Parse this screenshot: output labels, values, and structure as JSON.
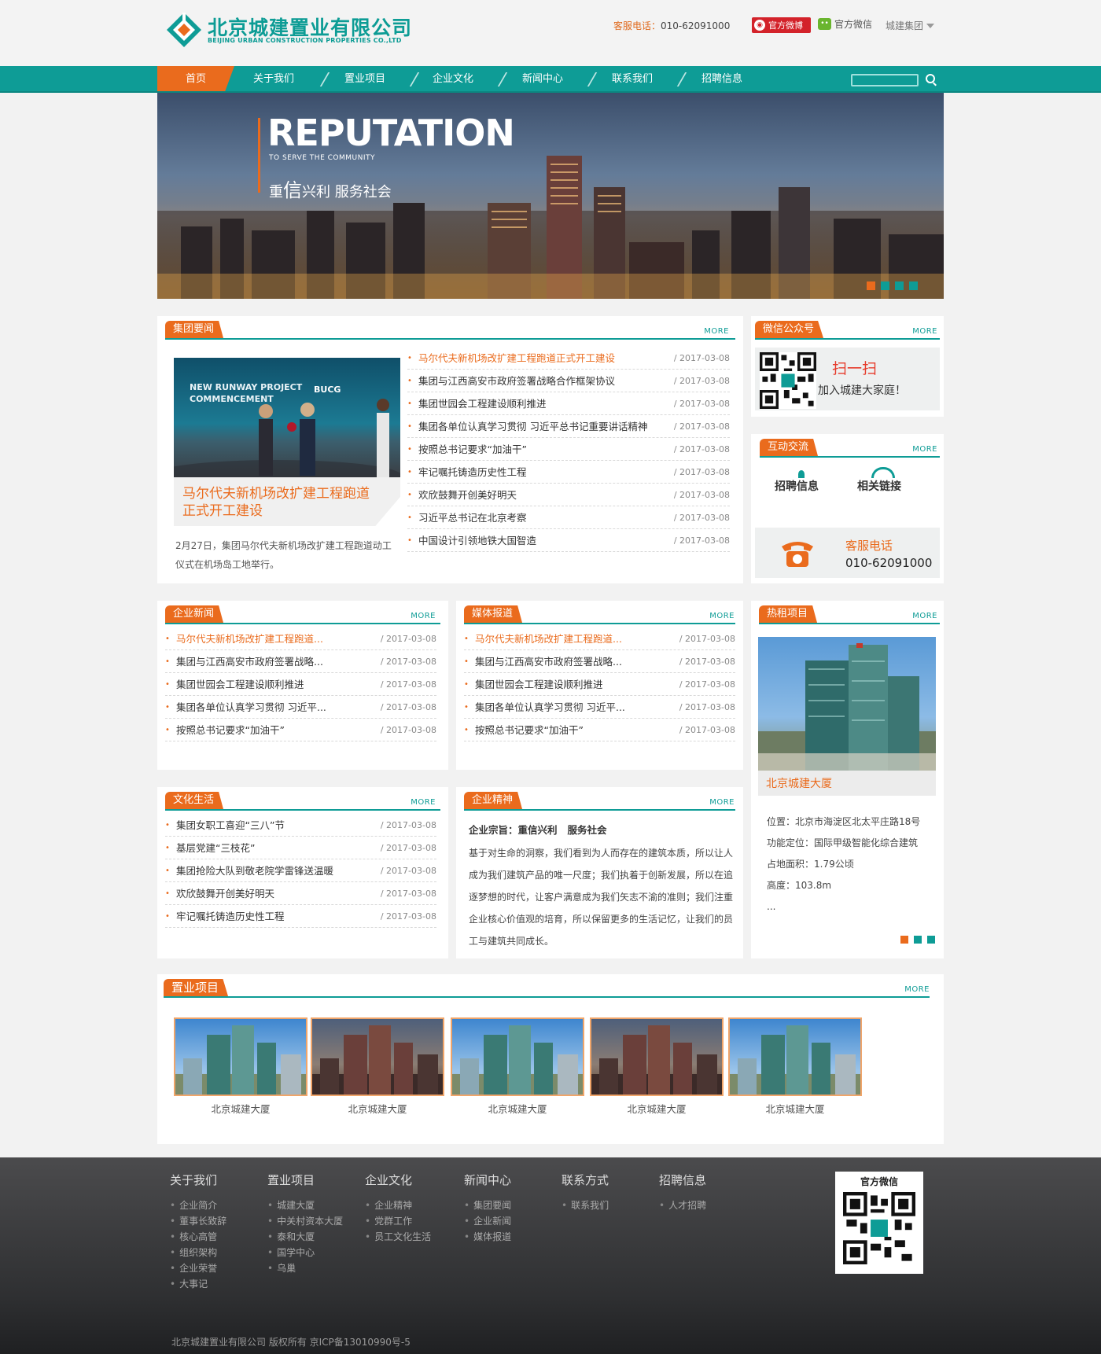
{
  "header": {
    "logo_cn": "北京城建置业有限公司",
    "logo_en": "BEIJING URBAN CONSTRUCTION PROPERTIES CO.,LTD",
    "hotline_label": "客服电话：",
    "hotline_number": "010-62091000",
    "weibo_label": "官方微博",
    "wechat_label": "官方微信",
    "group_label": "城建集团"
  },
  "nav": {
    "items": [
      "首页",
      "关于我们",
      "置业项目",
      "企业文化",
      "新闻中心",
      "联系我们",
      "招聘信息"
    ],
    "active_index": 0
  },
  "banner": {
    "title": "REPUTATION",
    "subtitle": "TO SERVE THE COMMUNITY",
    "slogan_prefix": "重",
    "slogan_big": "信",
    "slogan_rest": "兴利    服务社会"
  },
  "group_news": {
    "title": "集团要闻",
    "more": "MORE",
    "feature_photo_caption_lines": [
      "NEW RUNWAY PROJECT",
      "COMMENCEMENT",
      "BUCG"
    ],
    "feature_headline": "马尔代夫新机场改扩建工程跑道正式开工建设",
    "feature_summary": "2月27日，集团马尔代夫新机场改扩建工程跑道动工仪式在机场岛工地举行。",
    "items": [
      {
        "title": "马尔代夫新机场改扩建工程跑道正式开工建设",
        "date": "/ 2017-03-08"
      },
      {
        "title": "集团与江西高安市政府签署战略合作框架协议",
        "date": "/ 2017-03-08"
      },
      {
        "title": "集团世园会工程建设顺利推进",
        "date": "/ 2017-03-08"
      },
      {
        "title": "集团各单位认真学习贯彻 习近平总书记重要讲话精神",
        "date": "/ 2017-03-08"
      },
      {
        "title": "按照总书记要求“加油干”",
        "date": "/ 2017-03-08"
      },
      {
        "title": "牢记嘱托铸造历史性工程",
        "date": "/ 2017-03-08"
      },
      {
        "title": "欢欣鼓舞开创美好明天",
        "date": "/ 2017-03-08"
      },
      {
        "title": "习近平总书记在北京考察",
        "date": "/ 2017-03-08"
      },
      {
        "title": "中国设计引领地铁大国智造",
        "date": "/ 2017-03-08"
      }
    ]
  },
  "wechat_panel": {
    "title": "微信公众号",
    "more": "MORE",
    "scan": "扫一扫",
    "join": "加入城建大家庭！"
  },
  "interact": {
    "title": "互动交流",
    "more": "MORE",
    "recruit": "招聘信息",
    "links": "相关链接",
    "phone_label": "客服电话",
    "phone_number": "010-62091000"
  },
  "company_news": {
    "title": "企业新闻",
    "more": "MORE",
    "items": [
      {
        "title": "马尔代夫新机场改扩建工程跑道...",
        "date": "/ 2017-03-08"
      },
      {
        "title": "集团与江西高安市政府签署战略...",
        "date": "/ 2017-03-08"
      },
      {
        "title": "集团世园会工程建设顺利推进",
        "date": "/ 2017-03-08"
      },
      {
        "title": "集团各单位认真学习贯彻 习近平...",
        "date": "/ 2017-03-08"
      },
      {
        "title": "按照总书记要求“加油干”",
        "date": "/ 2017-03-08"
      }
    ]
  },
  "media_news": {
    "title": "媒体报道",
    "more": "MORE",
    "items": [
      {
        "title": "马尔代夫新机场改扩建工程跑道...",
        "date": "/ 2017-03-08"
      },
      {
        "title": "集团与江西高安市政府签署战略...",
        "date": "/ 2017-03-08"
      },
      {
        "title": "集团世园会工程建设顺利推进",
        "date": "/ 2017-03-08"
      },
      {
        "title": "集团各单位认真学习贯彻 习近平...",
        "date": "/ 2017-03-08"
      },
      {
        "title": "按照总书记要求“加油干”",
        "date": "/ 2017-03-08"
      }
    ]
  },
  "culture_life": {
    "title": "文化生活",
    "more": "MORE",
    "items": [
      {
        "title": "集团女职工喜迎“三八”节",
        "date": "/ 2017-03-08"
      },
      {
        "title": "基层党建“三枝花”",
        "date": "/ 2017-03-08"
      },
      {
        "title": "集团抢险大队到敬老院学雷锋送温暖",
        "date": "/ 2017-03-08"
      },
      {
        "title": "欢欣鼓舞开创美好明天",
        "date": "/ 2017-03-08"
      },
      {
        "title": "牢记嘱托铸造历史性工程",
        "date": "/ 2017-03-08"
      }
    ]
  },
  "spirit": {
    "title": "企业精神",
    "more": "MORE",
    "heading": "企业宗旨：重信兴利   服务社会",
    "lines": [
      "基于对生命的洞察，我们看到为人而存在的建筑本质，所以让人",
      "成为我们建筑产品的唯一尺度；我们执着于创新发展，所以在追",
      "逐梦想的时代，让客户满意成为我们矢志不渝的准则；我们注重",
      "企业核心价值观的培育，所以保留更多的生活记忆，让我们的员",
      "工与建筑共同成长。"
    ]
  },
  "hot_rent": {
    "title": "热租项目",
    "more": "MORE",
    "building_name": "北京城建大厦",
    "details": [
      "位置：北京市海淀区北太平庄路18号",
      "功能定位：国际甲级智能化综合建筑",
      "占地面积：1.79公顷",
      "高度：103.8m",
      "..."
    ]
  },
  "projects": {
    "title": "置业项目",
    "more": "MORE",
    "items": [
      "北京城建大厦",
      "北京城建大厦",
      "北京城建大厦",
      "北京城建大厦",
      "北京城建大厦"
    ]
  },
  "footer": {
    "columns": [
      {
        "heading": "关于我们",
        "items": [
          "企业简介",
          "董事长致辞",
          "核心高管",
          "组织架构",
          "企业荣誉",
          "大事记"
        ]
      },
      {
        "heading": "置业项目",
        "items": [
          "城建大厦",
          "中关村资本大厦",
          "泰和大厦",
          "国学中心",
          "乌巢"
        ]
      },
      {
        "heading": "企业文化",
        "items": [
          "企业精神",
          "党群工作",
          "员工文化生活"
        ]
      },
      {
        "heading": "新闻中心",
        "items": [
          "集团要闻",
          "企业新闻",
          "媒体报道"
        ]
      },
      {
        "heading": "联系方式",
        "items": [
          "联系我们"
        ]
      },
      {
        "heading": "招聘信息",
        "items": [
          "人才招聘"
        ]
      }
    ],
    "qr_title": "官方微信",
    "copyright": "北京城建置业有限公司 版权所有  京ICP备13010990号-5"
  },
  "colors": {
    "teal": "#0e9c96",
    "orange": "#ea6b1d"
  }
}
